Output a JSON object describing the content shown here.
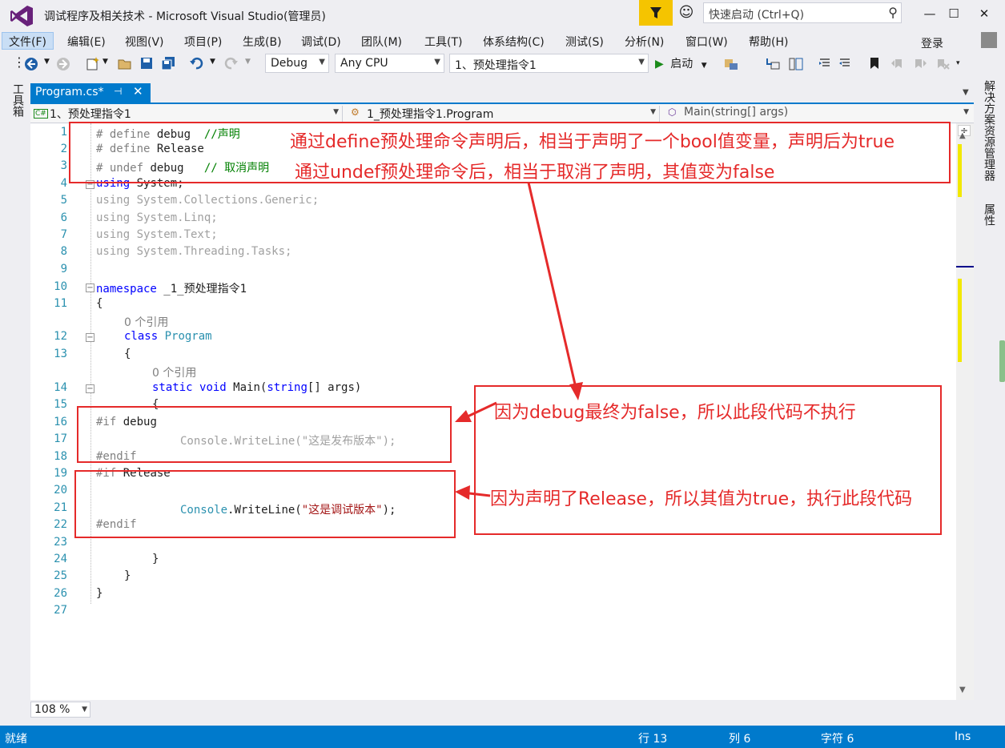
{
  "window": {
    "title": "调试程序及相关技术 - Microsoft Visual Studio(管理员)",
    "quick_launch_placeholder": "快速启动 (Ctrl+Q)",
    "minimize": "—",
    "maximize": "☐",
    "close": "✕"
  },
  "menu": {
    "items": [
      "文件(F)",
      "编辑(E)",
      "视图(V)",
      "项目(P)",
      "生成(B)",
      "调试(D)",
      "团队(M)",
      "工具(T)",
      "体系结构(C)",
      "测试(S)",
      "分析(N)",
      "窗口(W)",
      "帮助(H)"
    ],
    "login": "登录"
  },
  "toolbar": {
    "config": "Debug",
    "platform": "Any CPU",
    "startup_project": "1、预处理指令1",
    "start_label": "启动"
  },
  "side": {
    "toolbox": "工具箱",
    "solution_explorer": "解决方案资源管理器",
    "properties": "属性"
  },
  "tab": {
    "label": "Program.cs*",
    "pin": "⊣",
    "close": "✕"
  },
  "navbar": {
    "project": "1、预处理指令1",
    "class": "1_预处理指令1.Program",
    "member": "Main(string[] args)"
  },
  "code": {
    "line_numbers": [
      "1",
      "2",
      "3",
      "4",
      "5",
      "6",
      "7",
      "8",
      "9",
      "10",
      "11",
      "12",
      "13",
      "14",
      "15",
      "16",
      "17",
      "18",
      "19",
      "20",
      "21",
      "22",
      "23",
      "24",
      "25",
      "26",
      "27"
    ],
    "l1a": "# define ",
    "l1b": "debug",
    "l1c": "  //声明",
    "l2a": "# define ",
    "l2b": "Release",
    "l3a": "# undef ",
    "l3b": "debug",
    "l3c": "   // 取消声明",
    "l4a": "using",
    "l4b": " System;",
    "l5": "using System.Collections.Generic;",
    "l6": "using System.Linq;",
    "l7": "using System.Text;",
    "l8": "using System.Threading.Tasks;",
    "l10a": "namespace",
    "l10b": " _1_预处理指令1",
    "l11": "{",
    "refs1": "0 个引用",
    "l12a": "class",
    "l12b": "Program",
    "l13": "{",
    "refs2": "0 个引用",
    "l14a": "static",
    "l14b": "void",
    "l14c": " Main(",
    "l14d": "string",
    "l14e": "[] args)",
    "l15": "{",
    "l16a": "#if",
    "l16b": " debug",
    "l17a": "Console",
    "l17b": ".WriteLine(",
    "l17c": "\"这是发布版本\"",
    "l17d": ");",
    "l18": "#endif",
    "l19a": "#if",
    "l19b": " Release",
    "l21a": "Console",
    "l21b": ".WriteLine(",
    "l21c": "\"这是调试版本\"",
    "l21d": ");",
    "l22": "#endif",
    "l24": "}",
    "l25": "}",
    "l26": "}"
  },
  "annotations": {
    "top1": "通过define预处理命令声明后，相当于声明了一个bool值变量，声明后为true",
    "top2": "通过undef预处理命令后，相当于取消了声明，其值变为false",
    "mid": "因为debug最终为false，所以此段代码不执行",
    "bottom": "因为声明了Release，所以其值为true，执行此段代码"
  },
  "zoom": "108 %",
  "status": {
    "ready": "就绪",
    "line": "行 13",
    "col": "列 6",
    "char": "字符 6",
    "mode": "Ins"
  },
  "colors": {
    "accent": "#007acc",
    "annotation": "#e52a2a",
    "filter": "#f5c400"
  }
}
